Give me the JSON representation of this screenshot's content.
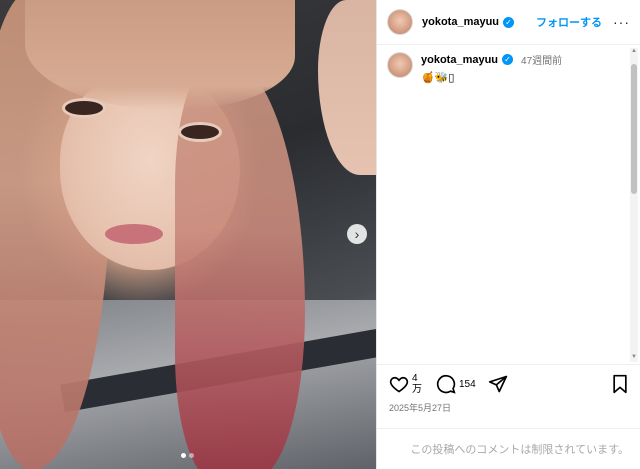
{
  "post": {
    "username": "yokota_mayuu",
    "follow_label": "フォローする",
    "more_label": "···",
    "caption": {
      "username": "yokota_mayuu",
      "time": "47週間前",
      "emojis": "🍯🐝▯"
    },
    "actions": {
      "likes_top": "4",
      "likes_bottom": "万",
      "comments": "154"
    },
    "date": "2025年5月27日",
    "comments_disabled": "この投稿へのコメントは制限されています。"
  },
  "icons": {
    "like": "heart-icon",
    "comment": "comment-icon",
    "share": "share-icon",
    "save": "bookmark-icon",
    "next": "chevron-right-icon",
    "verified": "verified-badge-icon"
  },
  "colors": {
    "accent": "#0095f6",
    "muted": "#737373"
  }
}
